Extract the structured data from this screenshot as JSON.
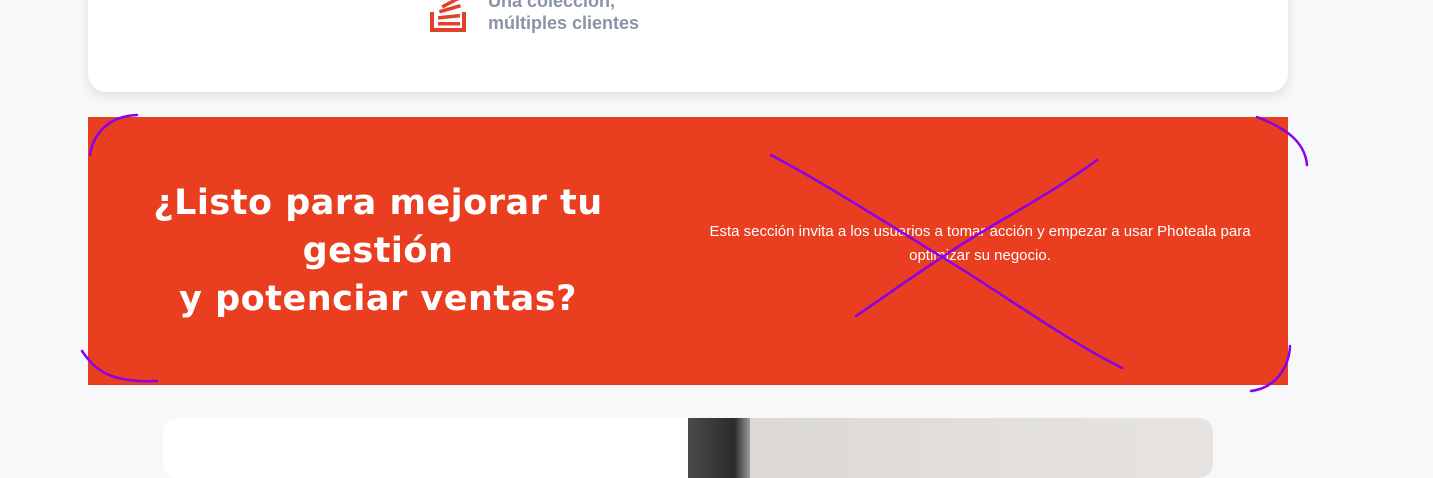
{
  "feature": {
    "line1": "Una colección,",
    "line2": "múltiples clientes",
    "icon": "stacked-layers-icon",
    "accent": "#e2402a",
    "text_color": "#8a94a6"
  },
  "cta": {
    "title_line1": "¿Listo para mejorar tu",
    "title_line2": "gestión",
    "title_line3": "y potenciar ventas?",
    "description": "Esta sección invita a los usuarios a tomar acción y empezar a usar Photeala para optimizar su negocio.",
    "background": "#e93e1f"
  },
  "annotations": {
    "color": "#8800ee"
  }
}
